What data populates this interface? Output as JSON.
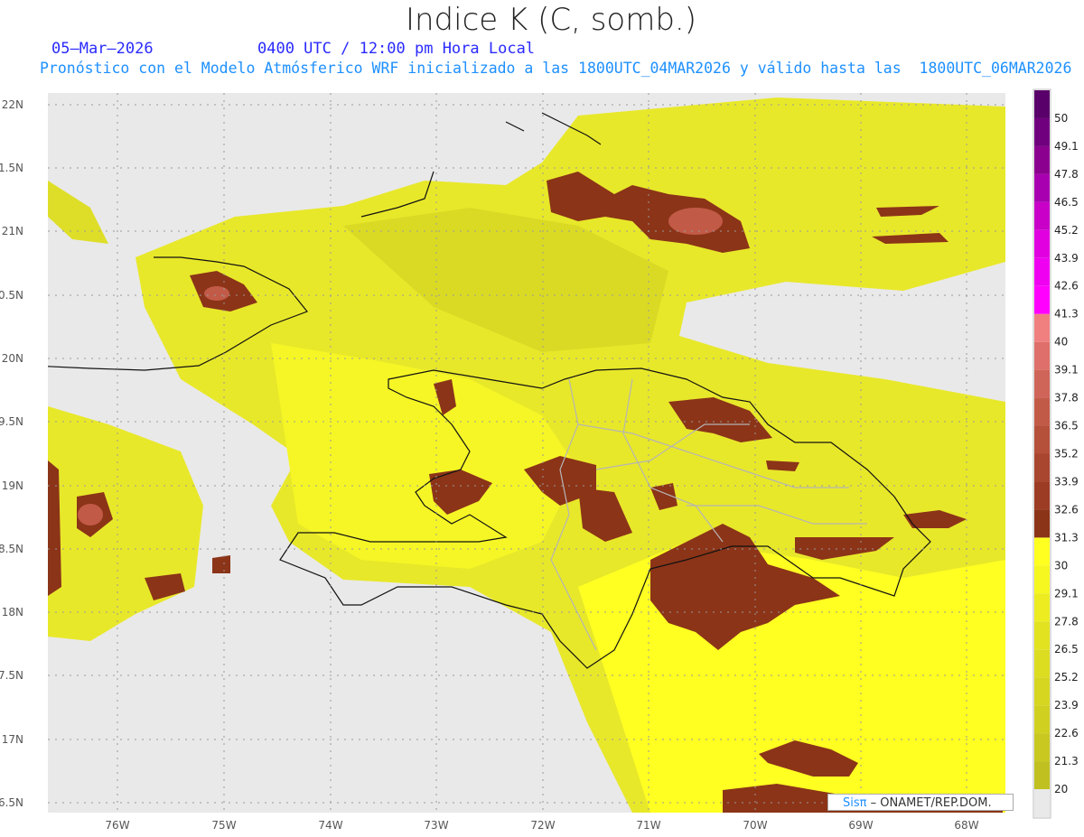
{
  "header": {
    "title": "Indice K (C, somb.)",
    "date": "05–Mar–2026",
    "time": "0400 UTC / 12:00 pm Hora Local",
    "subtitle": "Pronóstico con el Modelo Atmósferico WRF inicializado a las 1800UTC_04MAR2026 y válido hasta las  1800UTC_06MAR2026"
  },
  "map": {
    "lon_labels": [
      "76W",
      "75W",
      "74W",
      "73W",
      "72W",
      "71W",
      "70W",
      "69W",
      "68W"
    ],
    "lat_labels": [
      "22N",
      "1.5N",
      "21N",
      "0.5N",
      "20N",
      "9.5N",
      "19N",
      "8.5N",
      "18N",
      "7.5N",
      "17N",
      "6.5N"
    ],
    "background_color": "#e9e9e9"
  },
  "colorbar": {
    "labels": [
      "20",
      "21.3",
      "22.6",
      "23.9",
      "25.2",
      "26.5",
      "27.8",
      "29.1",
      "30",
      "31.3",
      "32.6",
      "33.9",
      "35.2",
      "36.5",
      "37.8",
      "39.1",
      "40",
      "41.3",
      "42.6",
      "43.9",
      "45.2",
      "46.5",
      "47.8",
      "49.1",
      "50"
    ],
    "colors": [
      "#e9e9e9",
      "#c0c020",
      "#c8c820",
      "#d0d020",
      "#d6d620",
      "#dcdc20",
      "#e2e220",
      "#ecec20",
      "#f6f620",
      "#ffff20",
      "#8b3418",
      "#9c3c24",
      "#a8462f",
      "#b5503a",
      "#c25a48",
      "#cf6558",
      "#df6f6a",
      "#f08080",
      "#ff00ff",
      "#f000f0",
      "#e000e0",
      "#c800c8",
      "#a800b0",
      "#8c0090",
      "#70007e",
      "#5a006a"
    ]
  },
  "credit": {
    "brand": "Sisπ",
    "text": " –  ONAMET/REP.DOM."
  }
}
